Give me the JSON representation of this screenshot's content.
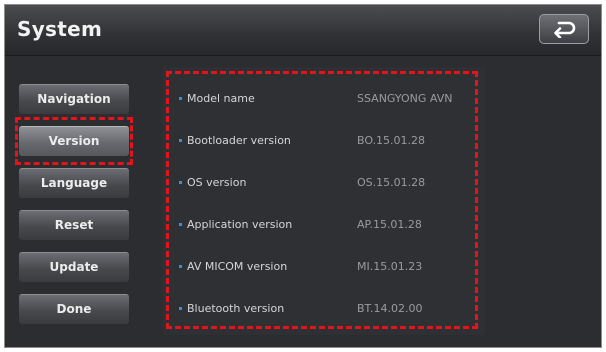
{
  "header": {
    "title": "System",
    "back_icon": "back-arrow-icon"
  },
  "sidebar": {
    "items": [
      {
        "label": "Navigation",
        "active": false
      },
      {
        "label": "Version",
        "active": true
      },
      {
        "label": "Language",
        "active": false
      },
      {
        "label": "Reset",
        "active": false
      },
      {
        "label": "Update",
        "active": false
      },
      {
        "label": "Done",
        "active": false
      }
    ]
  },
  "version_info": {
    "rows": [
      {
        "label": "Model name",
        "value": "SSANGYONG AVN"
      },
      {
        "label": "Bootloader version",
        "value": "BO.15.01.28"
      },
      {
        "label": "OS version",
        "value": "OS.15.01.28"
      },
      {
        "label": "Application version",
        "value": "AP.15.01.28"
      },
      {
        "label": "AV MICOM version",
        "value": "MI.15.01.23"
      },
      {
        "label": "Bluetooth version",
        "value": "BT.14.02.00"
      }
    ]
  },
  "colors": {
    "highlight": "#e3141c",
    "bullet": "#3a8fd6",
    "background": "#2b2d30"
  }
}
